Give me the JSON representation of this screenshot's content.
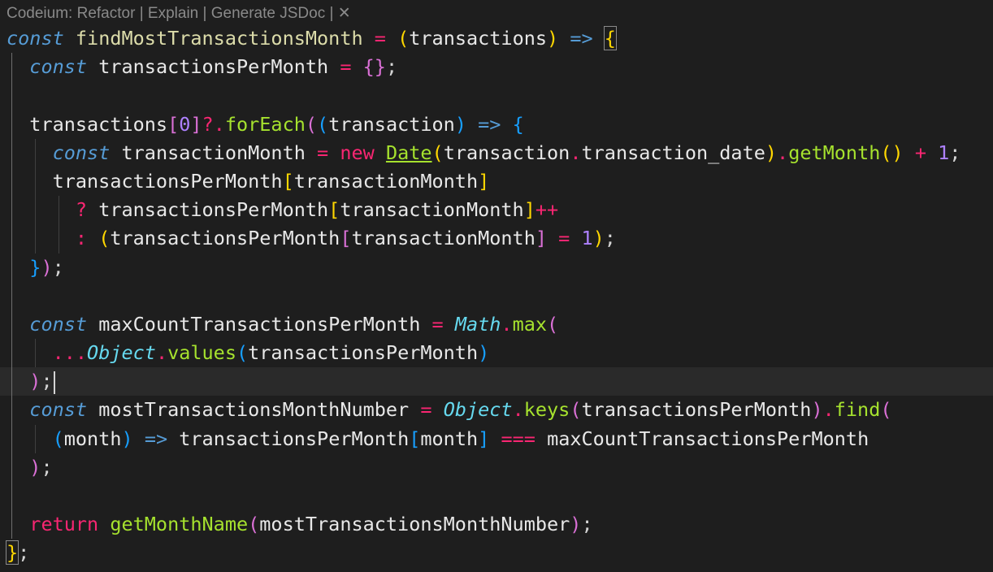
{
  "codelens": {
    "prefix": "Codeium: ",
    "refactor": "Refactor",
    "sep1": " | ",
    "explain": "Explain",
    "sep2": " | ",
    "jsdoc": "Generate JSDoc",
    "sep3": " | ",
    "close": "✕"
  },
  "code": {
    "fn_name": "findMostTransactionsMonth",
    "param": "transactions",
    "var_per_month": "transactionsPerMonth",
    "var_item": "transaction",
    "var_month": "transactionMonth",
    "date_field": "transaction_date",
    "var_max": "maxCountTransactionsPerMonth",
    "var_most": "mostTransactionsMonthNumber",
    "arrow_param": "month",
    "helper_fn": "getMonthName",
    "kw_const": "const",
    "kw_new": "new",
    "kw_return": "return",
    "cls_date": "Date",
    "cls_math": "Math",
    "cls_object": "Object",
    "m_foreach": "forEach",
    "m_getmonth": "getMonth",
    "m_max": "max",
    "m_values": "values",
    "m_keys": "keys",
    "m_find": "find",
    "num_zero": "0",
    "num_one": "1"
  }
}
